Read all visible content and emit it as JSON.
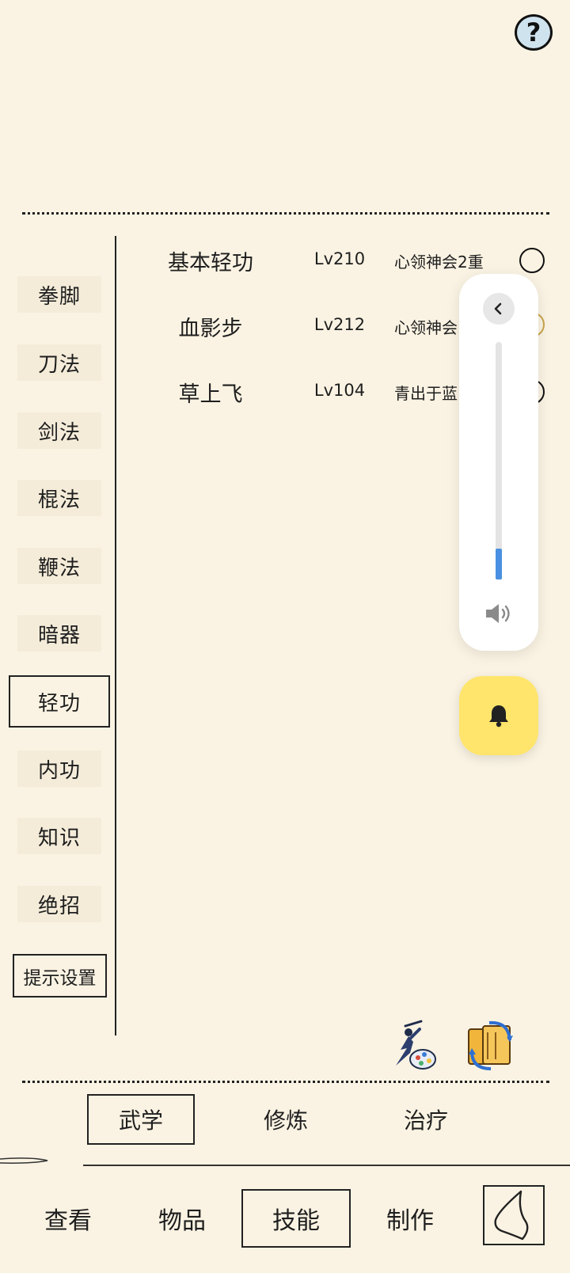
{
  "help": {
    "glyph": "?"
  },
  "categories": [
    {
      "label": "拳脚",
      "active": false
    },
    {
      "label": "刀法",
      "active": false
    },
    {
      "label": "剑法",
      "active": false
    },
    {
      "label": "棍法",
      "active": false
    },
    {
      "label": "鞭法",
      "active": false
    },
    {
      "label": "暗器",
      "active": false
    },
    {
      "label": "轻功",
      "active": true
    },
    {
      "label": "内功",
      "active": false
    },
    {
      "label": "知识",
      "active": false
    },
    {
      "label": "绝招",
      "active": false
    }
  ],
  "hint_settings_label": "提示设置",
  "skills": [
    {
      "name": "基本轻功",
      "level": "Lv210",
      "state": "心领神会2重"
    },
    {
      "name": "血影步",
      "level": "Lv212",
      "state": "心领神会"
    },
    {
      "name": "草上飞",
      "level": "Lv104",
      "state": "青出于蓝"
    }
  ],
  "volume": {
    "level_fraction": 0.13,
    "accent": "#4a90e2",
    "icon": "speaker-icon"
  },
  "notification": {
    "icon": "bell-icon",
    "color": "#ffe56b"
  },
  "subtabs": [
    {
      "label": "武学",
      "active": true
    },
    {
      "label": "修炼",
      "active": false
    },
    {
      "label": "治疗",
      "active": false
    }
  ],
  "nav": [
    {
      "label": "查看",
      "active": false
    },
    {
      "label": "物品",
      "active": false
    },
    {
      "label": "技能",
      "active": true
    },
    {
      "label": "制作",
      "active": false
    }
  ],
  "back": {
    "icon": "back-arrow-icon"
  }
}
